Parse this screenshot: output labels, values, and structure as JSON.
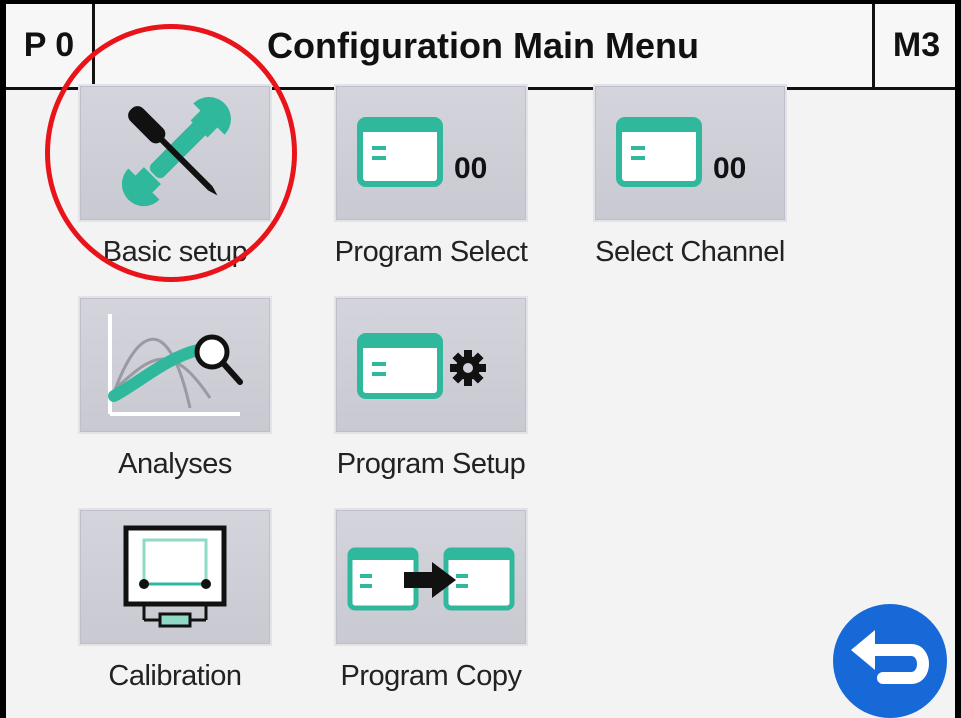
{
  "header": {
    "left_label": "P 0",
    "title": "Configuration Main Menu",
    "right_label": "M3"
  },
  "tiles": [
    {
      "label": "Basic setup",
      "icon": "wrench-screwdriver-icon"
    },
    {
      "label": "Program Select",
      "icon": "program-window-icon",
      "value": "00"
    },
    {
      "label": "Select Channel",
      "icon": "channel-window-icon",
      "value": "00"
    },
    {
      "label": "Analyses",
      "icon": "analysis-graph-icon"
    },
    {
      "label": "Program Setup",
      "icon": "program-gear-icon"
    },
    {
      "label": "Calibration",
      "icon": "calibration-board-icon"
    },
    {
      "label": "Program Copy",
      "icon": "program-copy-icon"
    }
  ],
  "back_button": {
    "icon": "back-arrow-icon"
  },
  "colors": {
    "accent_teal": "#2fb89c",
    "back_blue": "#1669d6",
    "highlight_red": "#e8141a"
  }
}
